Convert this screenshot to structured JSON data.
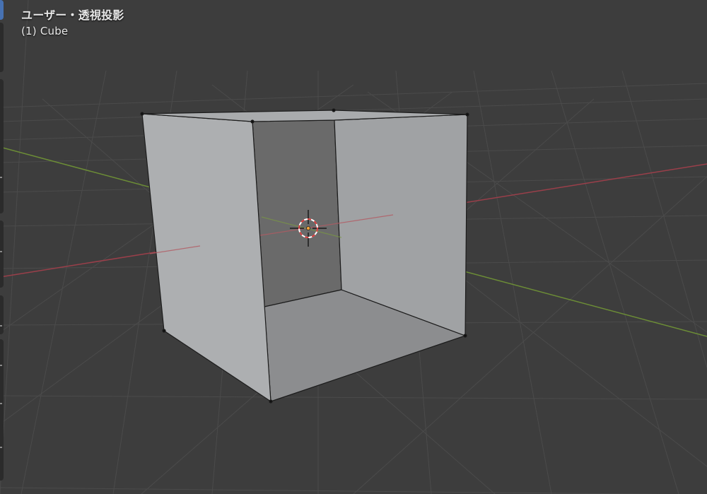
{
  "viewport": {
    "view_title": "ユーザー・透視投影",
    "object_name": "(1) Cube"
  },
  "colors": {
    "background": "#3d3d3d",
    "grid": "#4a4a4a",
    "x_axis": "#9a3f4a",
    "y_axis": "#6c8d36",
    "cube_face_light": "#a1a3a5",
    "cube_face_left": "#aeb0b2",
    "cube_face_inner_back": "#6a6a6a",
    "cube_face_inner_bottom": "#8c8c8e",
    "toolbar_active": "#4772b3"
  },
  "icons": {
    "cursor": "3d-cursor-icon",
    "origin": "object-origin-icon"
  }
}
